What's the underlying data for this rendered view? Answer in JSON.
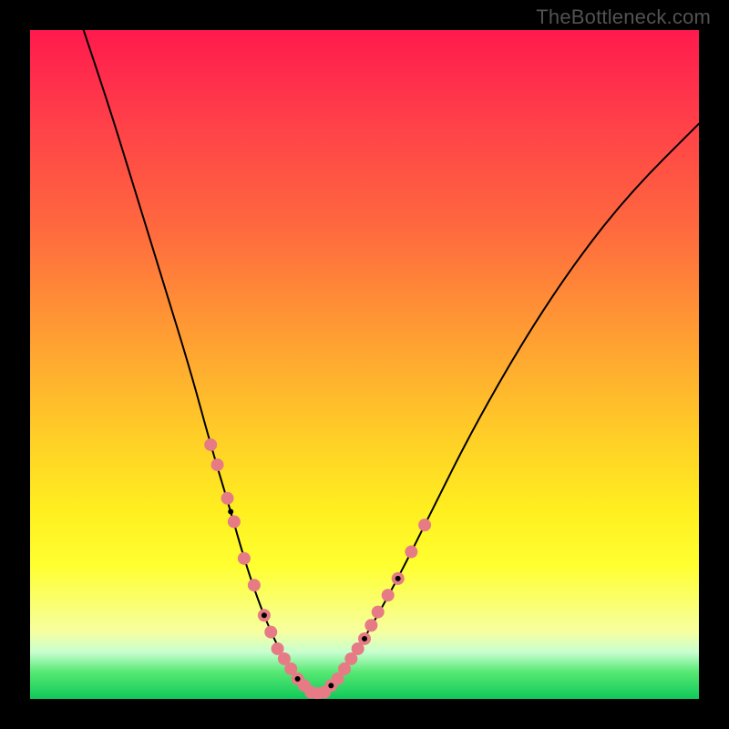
{
  "watermark": "TheBottleneck.com",
  "chart_data": {
    "type": "line",
    "title": "",
    "xlabel": "",
    "ylabel": "",
    "xlim": [
      0,
      100
    ],
    "ylim": [
      0,
      100
    ],
    "series": [
      {
        "name": "bottleneck-curve",
        "x": [
          8,
          12,
          16,
          20,
          24,
          27,
          30,
          32,
          34,
          36,
          38,
          40,
          42,
          44,
          46,
          50,
          55,
          60,
          66,
          74,
          82,
          90,
          100
        ],
        "y": [
          100,
          88,
          75,
          62,
          49,
          38,
          28,
          21,
          15,
          10,
          6,
          3,
          1,
          1,
          3,
          9,
          18,
          28,
          40,
          54,
          66,
          76,
          86
        ]
      }
    ],
    "highlight_points_left": {
      "name": "highlight-left",
      "x": [
        27,
        28,
        29.5,
        30.5,
        32,
        33.5,
        35,
        36,
        37,
        38,
        39,
        40,
        41
      ],
      "y": [
        38,
        35,
        30,
        26.5,
        21,
        17,
        12.5,
        10,
        7.5,
        6,
        4.5,
        3,
        2
      ]
    },
    "highlight_points_right": {
      "name": "highlight-right",
      "x": [
        42,
        43,
        44,
        45,
        46,
        47,
        48,
        49,
        50,
        51,
        52,
        53.5,
        55,
        57,
        59
      ],
      "y": [
        1,
        0.8,
        1,
        2,
        3,
        4.5,
        6,
        7.5,
        9,
        11,
        13,
        15.5,
        18,
        22,
        26
      ]
    },
    "black_points": {
      "name": "black-dots",
      "x": [
        30,
        35,
        40,
        45,
        50,
        55
      ],
      "y": [
        28,
        12.5,
        3,
        2,
        9,
        18
      ]
    },
    "gradient_stops": [
      {
        "pos": 0,
        "color": "#ff1a4d"
      },
      {
        "pos": 48,
        "color": "#ffa531"
      },
      {
        "pos": 80,
        "color": "#ffff30"
      },
      {
        "pos": 100,
        "color": "#10c95a"
      }
    ]
  }
}
